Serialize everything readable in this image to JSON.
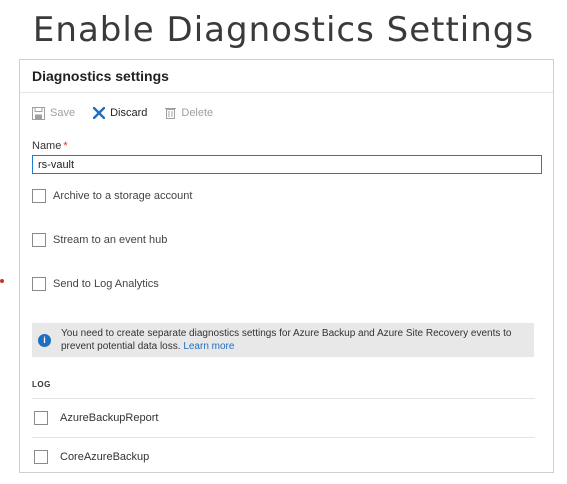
{
  "slide": {
    "title": "Enable Diagnostics Settings"
  },
  "panel": {
    "title": "Diagnostics settings",
    "toolbar": {
      "save_label": "Save",
      "discard_label": "Discard",
      "delete_label": "Delete"
    },
    "name_field": {
      "label": "Name",
      "required_mark": "*",
      "value": "rs-vault"
    },
    "options": [
      {
        "label": "Archive to a storage account",
        "checked": false
      },
      {
        "label": "Stream to an event hub",
        "checked": false
      },
      {
        "label": "Send to Log Analytics",
        "checked": false
      }
    ],
    "info": {
      "message": "You need to create separate diagnostics settings for Azure Backup and Azure Site Recovery events to prevent potential data loss.",
      "link_text": "Learn more",
      "icon": "info-icon"
    },
    "log": {
      "heading": "LOG",
      "items": [
        {
          "label": "AzureBackupReport",
          "checked": false
        },
        {
          "label": "CoreAzureBackup",
          "checked": false
        }
      ]
    }
  },
  "colors": {
    "accent": "#1f6fbf",
    "input_border": "#1f7ad1",
    "required": "#d93025",
    "info_bg": "#e8e8e8"
  }
}
